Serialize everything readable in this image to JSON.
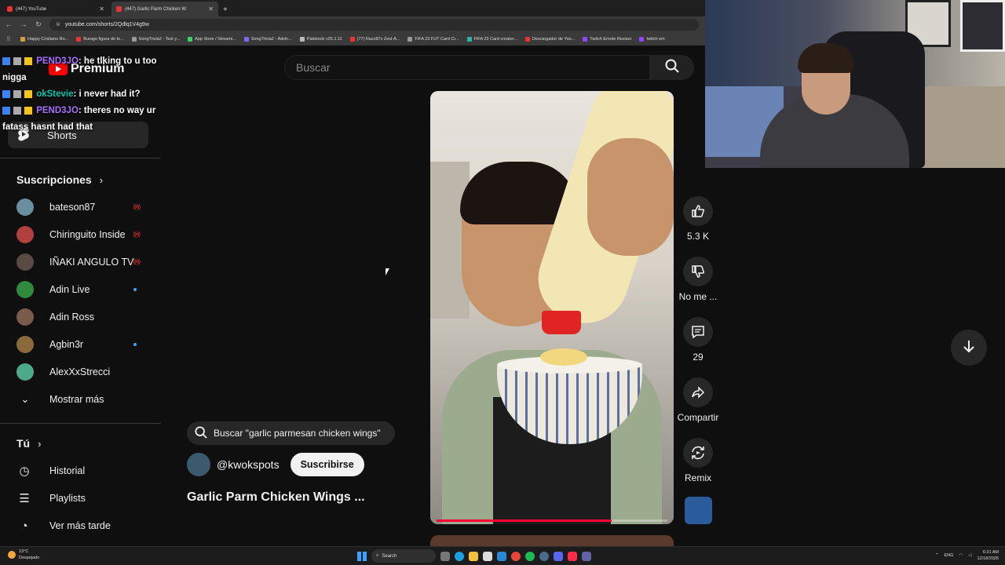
{
  "browser": {
    "tabs": [
      {
        "label": "(447) YouTube",
        "active": false
      },
      {
        "label": "(447) Garlic Parm Chicken W",
        "active": true
      }
    ],
    "url": "youtube.com/shorts/2Qdlq1V4g9w",
    "bookmarks": [
      "Happy Cristiano Ro...",
      "Burago figura de to...",
      "SongTrivia2 - Test y...",
      "App Store / Streami...",
      "SongTrivia2 - Advin...",
      "Paletools v25.1.11",
      "(77) Razz87s Zesl-A...",
      "FIFA 23 FUT Card Cr...",
      "FIFA 23 Card creator...",
      "Descargador de Yoo...",
      "Twitch Emote Resizer",
      "twitch em"
    ]
  },
  "logo": {
    "text": "Premium"
  },
  "search": {
    "placeholder": "Buscar"
  },
  "sidebar": {
    "shorts_label": "Shorts",
    "subscriptions_heading": "Suscripciones",
    "subscriptions": [
      {
        "name": "bateson87",
        "status": "live",
        "color": "#6b8e9e"
      },
      {
        "name": "Chiringuito Inside",
        "status": "live",
        "color": "#b0413e"
      },
      {
        "name": "IÑAKI ANGULO TV",
        "status": "live",
        "color": "#5a4a44"
      },
      {
        "name": "Adin Live",
        "status": "new",
        "color": "#2f8a3e"
      },
      {
        "name": "Adin Ross",
        "status": "",
        "color": "#7a5a48"
      },
      {
        "name": "Agbin3r",
        "status": "new",
        "color": "#8a6a3a"
      },
      {
        "name": "AlexXxStrecci",
        "status": "",
        "color": "#4ea98a"
      }
    ],
    "show_more": "Mostrar más",
    "you_heading": "Tú",
    "you_items": [
      {
        "label": "Historial",
        "icon": "history-icon"
      },
      {
        "label": "Playlists",
        "icon": "playlists-icon"
      },
      {
        "label": "Ver más tarde",
        "icon": "watch-later-icon"
      }
    ]
  },
  "chat": [
    {
      "user": "PEND3JO",
      "text": ": he tlking to u too nigga"
    },
    {
      "user": "okStevie",
      "text": ": i never had it?"
    },
    {
      "user": "PEND3JO",
      "text": ": theres no way ur fatass hasnt had that"
    }
  ],
  "video": {
    "progress": 0.76
  },
  "actions": {
    "like_count": "5.3 K",
    "dislike_label": "No me ...",
    "comments_count": "29",
    "share_label": "Compartir",
    "remix_label": "Remix"
  },
  "info": {
    "suggestion": "Buscar \"garlic parmesan chicken wings\"",
    "channel": "@kwokspots",
    "subscribe": "Suscribirse",
    "title": "Garlic Parm Chicken Wings ..."
  },
  "taskbar": {
    "temp": "13°C",
    "weather": "Despejado",
    "search": "Search",
    "lang": "ENG",
    "time": "6:31 AM",
    "date": "12/18/2025"
  },
  "colors": {
    "accent": "#ff0000",
    "background": "#0f0f0f",
    "live": "#e33333",
    "new_dot": "#3ea6ff"
  }
}
